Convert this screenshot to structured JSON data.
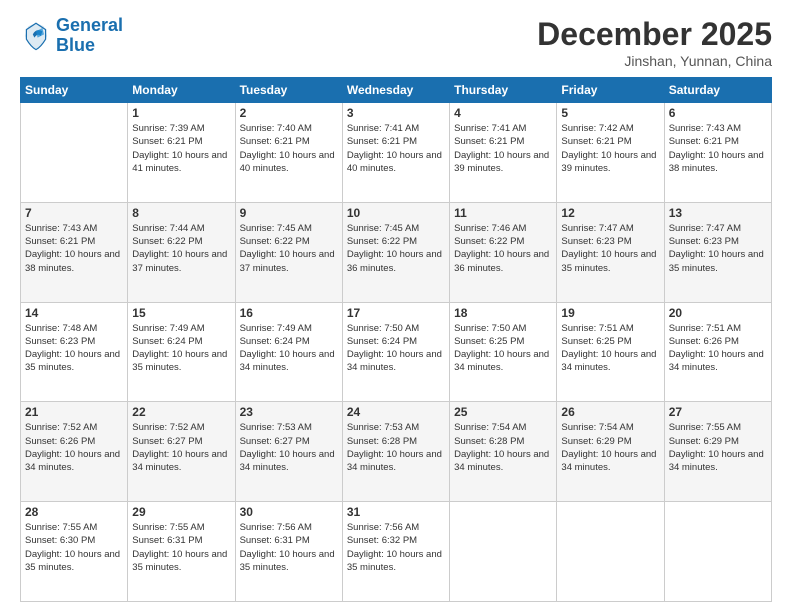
{
  "header": {
    "logo": {
      "line1": "General",
      "line2": "Blue"
    },
    "month": "December 2025",
    "location": "Jinshan, Yunnan, China"
  },
  "weekdays": [
    "Sunday",
    "Monday",
    "Tuesday",
    "Wednesday",
    "Thursday",
    "Friday",
    "Saturday"
  ],
  "weeks": [
    [
      {
        "day": "",
        "sunrise": "",
        "sunset": "",
        "daylight": ""
      },
      {
        "day": "1",
        "sunrise": "Sunrise: 7:39 AM",
        "sunset": "Sunset: 6:21 PM",
        "daylight": "Daylight: 10 hours and 41 minutes."
      },
      {
        "day": "2",
        "sunrise": "Sunrise: 7:40 AM",
        "sunset": "Sunset: 6:21 PM",
        "daylight": "Daylight: 10 hours and 40 minutes."
      },
      {
        "day": "3",
        "sunrise": "Sunrise: 7:41 AM",
        "sunset": "Sunset: 6:21 PM",
        "daylight": "Daylight: 10 hours and 40 minutes."
      },
      {
        "day": "4",
        "sunrise": "Sunrise: 7:41 AM",
        "sunset": "Sunset: 6:21 PM",
        "daylight": "Daylight: 10 hours and 39 minutes."
      },
      {
        "day": "5",
        "sunrise": "Sunrise: 7:42 AM",
        "sunset": "Sunset: 6:21 PM",
        "daylight": "Daylight: 10 hours and 39 minutes."
      },
      {
        "day": "6",
        "sunrise": "Sunrise: 7:43 AM",
        "sunset": "Sunset: 6:21 PM",
        "daylight": "Daylight: 10 hours and 38 minutes."
      }
    ],
    [
      {
        "day": "7",
        "sunrise": "Sunrise: 7:43 AM",
        "sunset": "Sunset: 6:21 PM",
        "daylight": "Daylight: 10 hours and 38 minutes."
      },
      {
        "day": "8",
        "sunrise": "Sunrise: 7:44 AM",
        "sunset": "Sunset: 6:22 PM",
        "daylight": "Daylight: 10 hours and 37 minutes."
      },
      {
        "day": "9",
        "sunrise": "Sunrise: 7:45 AM",
        "sunset": "Sunset: 6:22 PM",
        "daylight": "Daylight: 10 hours and 37 minutes."
      },
      {
        "day": "10",
        "sunrise": "Sunrise: 7:45 AM",
        "sunset": "Sunset: 6:22 PM",
        "daylight": "Daylight: 10 hours and 36 minutes."
      },
      {
        "day": "11",
        "sunrise": "Sunrise: 7:46 AM",
        "sunset": "Sunset: 6:22 PM",
        "daylight": "Daylight: 10 hours and 36 minutes."
      },
      {
        "day": "12",
        "sunrise": "Sunrise: 7:47 AM",
        "sunset": "Sunset: 6:23 PM",
        "daylight": "Daylight: 10 hours and 35 minutes."
      },
      {
        "day": "13",
        "sunrise": "Sunrise: 7:47 AM",
        "sunset": "Sunset: 6:23 PM",
        "daylight": "Daylight: 10 hours and 35 minutes."
      }
    ],
    [
      {
        "day": "14",
        "sunrise": "Sunrise: 7:48 AM",
        "sunset": "Sunset: 6:23 PM",
        "daylight": "Daylight: 10 hours and 35 minutes."
      },
      {
        "day": "15",
        "sunrise": "Sunrise: 7:49 AM",
        "sunset": "Sunset: 6:24 PM",
        "daylight": "Daylight: 10 hours and 35 minutes."
      },
      {
        "day": "16",
        "sunrise": "Sunrise: 7:49 AM",
        "sunset": "Sunset: 6:24 PM",
        "daylight": "Daylight: 10 hours and 34 minutes."
      },
      {
        "day": "17",
        "sunrise": "Sunrise: 7:50 AM",
        "sunset": "Sunset: 6:24 PM",
        "daylight": "Daylight: 10 hours and 34 minutes."
      },
      {
        "day": "18",
        "sunrise": "Sunrise: 7:50 AM",
        "sunset": "Sunset: 6:25 PM",
        "daylight": "Daylight: 10 hours and 34 minutes."
      },
      {
        "day": "19",
        "sunrise": "Sunrise: 7:51 AM",
        "sunset": "Sunset: 6:25 PM",
        "daylight": "Daylight: 10 hours and 34 minutes."
      },
      {
        "day": "20",
        "sunrise": "Sunrise: 7:51 AM",
        "sunset": "Sunset: 6:26 PM",
        "daylight": "Daylight: 10 hours and 34 minutes."
      }
    ],
    [
      {
        "day": "21",
        "sunrise": "Sunrise: 7:52 AM",
        "sunset": "Sunset: 6:26 PM",
        "daylight": "Daylight: 10 hours and 34 minutes."
      },
      {
        "day": "22",
        "sunrise": "Sunrise: 7:52 AM",
        "sunset": "Sunset: 6:27 PM",
        "daylight": "Daylight: 10 hours and 34 minutes."
      },
      {
        "day": "23",
        "sunrise": "Sunrise: 7:53 AM",
        "sunset": "Sunset: 6:27 PM",
        "daylight": "Daylight: 10 hours and 34 minutes."
      },
      {
        "day": "24",
        "sunrise": "Sunrise: 7:53 AM",
        "sunset": "Sunset: 6:28 PM",
        "daylight": "Daylight: 10 hours and 34 minutes."
      },
      {
        "day": "25",
        "sunrise": "Sunrise: 7:54 AM",
        "sunset": "Sunset: 6:28 PM",
        "daylight": "Daylight: 10 hours and 34 minutes."
      },
      {
        "day": "26",
        "sunrise": "Sunrise: 7:54 AM",
        "sunset": "Sunset: 6:29 PM",
        "daylight": "Daylight: 10 hours and 34 minutes."
      },
      {
        "day": "27",
        "sunrise": "Sunrise: 7:55 AM",
        "sunset": "Sunset: 6:29 PM",
        "daylight": "Daylight: 10 hours and 34 minutes."
      }
    ],
    [
      {
        "day": "28",
        "sunrise": "Sunrise: 7:55 AM",
        "sunset": "Sunset: 6:30 PM",
        "daylight": "Daylight: 10 hours and 35 minutes."
      },
      {
        "day": "29",
        "sunrise": "Sunrise: 7:55 AM",
        "sunset": "Sunset: 6:31 PM",
        "daylight": "Daylight: 10 hours and 35 minutes."
      },
      {
        "day": "30",
        "sunrise": "Sunrise: 7:56 AM",
        "sunset": "Sunset: 6:31 PM",
        "daylight": "Daylight: 10 hours and 35 minutes."
      },
      {
        "day": "31",
        "sunrise": "Sunrise: 7:56 AM",
        "sunset": "Sunset: 6:32 PM",
        "daylight": "Daylight: 10 hours and 35 minutes."
      },
      {
        "day": "",
        "sunrise": "",
        "sunset": "",
        "daylight": ""
      },
      {
        "day": "",
        "sunrise": "",
        "sunset": "",
        "daylight": ""
      },
      {
        "day": "",
        "sunrise": "",
        "sunset": "",
        "daylight": ""
      }
    ]
  ]
}
